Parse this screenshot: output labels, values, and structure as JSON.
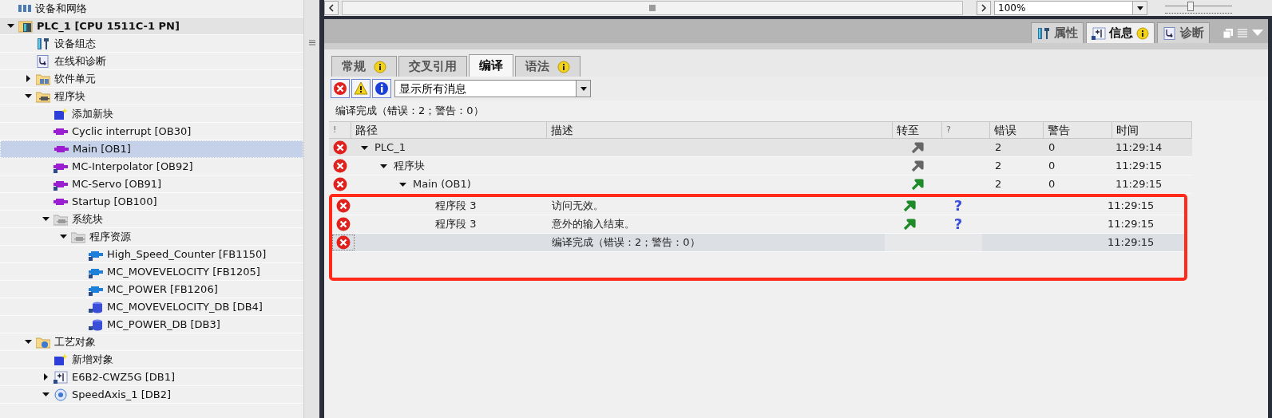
{
  "project_tree": {
    "items": [
      {
        "label": "设备和网络",
        "kind": "network",
        "selected": false
      },
      {
        "label": "PLC_1 [CPU 1511C-1 PN]",
        "kind": "plc",
        "expanded": true,
        "selected": false,
        "children": [
          {
            "label": "设备组态",
            "kind": "config",
            "selected": false
          },
          {
            "label": "在线和诊断",
            "kind": "diag",
            "selected": false
          },
          {
            "label": "软件单元",
            "kind": "unit_folder",
            "expanded": false,
            "selected": false
          },
          {
            "label": "程序块",
            "kind": "block_folder",
            "expanded": true,
            "selected": false,
            "children": [
              {
                "label": "添加新块",
                "kind": "add",
                "selected": false
              },
              {
                "label": "Cyclic interrupt [OB30]",
                "kind": "ob",
                "selected": false
              },
              {
                "label": "Main [OB1]",
                "kind": "ob",
                "selected": true
              },
              {
                "label": "MC-Interpolator [OB92]",
                "kind": "ob_lock",
                "selected": false
              },
              {
                "label": "MC-Servo [OB91]",
                "kind": "ob_lock",
                "selected": false
              },
              {
                "label": "Startup [OB100]",
                "kind": "ob",
                "selected": false
              },
              {
                "label": "系统块",
                "kind": "gray_folder",
                "expanded": true,
                "selected": false,
                "children": [
                  {
                    "label": "程序资源",
                    "kind": "gray_folder",
                    "expanded": true,
                    "selected": false,
                    "children": [
                      {
                        "label": "High_Speed_Counter [FB1150]",
                        "kind": "fb_lock",
                        "selected": false
                      },
                      {
                        "label": "MC_MOVEVELOCITY [FB1205]",
                        "kind": "fb_lock",
                        "selected": false
                      },
                      {
                        "label": "MC_POWER [FB1206]",
                        "kind": "fb_lock",
                        "selected": false
                      },
                      {
                        "label": "MC_MOVEVELOCITY_DB [DB4]",
                        "kind": "db_lock",
                        "selected": false
                      },
                      {
                        "label": "MC_POWER_DB [DB3]",
                        "kind": "db_lock",
                        "selected": false
                      }
                    ]
                  }
                ]
              }
            ]
          },
          {
            "label": "工艺对象",
            "kind": "tech_folder",
            "expanded": true,
            "selected": false,
            "children": [
              {
                "label": "新增对象",
                "kind": "add",
                "selected": false
              },
              {
                "label": "E6B2-CWZ5G [DB1]",
                "kind": "counter",
                "expanded": false,
                "selected": false
              },
              {
                "label": "SpeedAxis_1 [DB2]",
                "kind": "axis",
                "expanded": true,
                "selected": false
              }
            ]
          }
        ]
      }
    ]
  },
  "editor_toolbar": {
    "zoom": "100%",
    "zoom_slider": {
      "level": 0.38
    }
  },
  "inspector_tabs": [
    {
      "label": "属性",
      "kind": "properties",
      "badge": false,
      "selected": false
    },
    {
      "label": "信息",
      "kind": "info",
      "badge": true,
      "selected": true
    },
    {
      "label": "诊断",
      "kind": "diag",
      "badge": false,
      "selected": false
    }
  ],
  "info_tabs": [
    {
      "label": "常规",
      "badge": true,
      "selected": false
    },
    {
      "label": "交叉引用",
      "badge": false,
      "selected": false
    },
    {
      "label": "编译",
      "badge": false,
      "selected": true
    },
    {
      "label": "语法",
      "badge": true,
      "selected": false
    }
  ],
  "filter_buttons": [
    {
      "kind": "error"
    },
    {
      "kind": "warning"
    },
    {
      "kind": "info"
    }
  ],
  "filter_select": {
    "value": "显示所有消息"
  },
  "summary": "编译完成（错误：2；警告：0）",
  "table": {
    "columns": [
      "!",
      "路径",
      "描述",
      "转至",
      "?",
      "错误",
      "警告",
      "时间"
    ],
    "rows": [
      {
        "kind": "error",
        "path": "PLC_1",
        "expanded": true,
        "goto_enabled": false,
        "errors": "2",
        "warnings": "0",
        "time": "11:29:14",
        "selected": false,
        "children": [
          {
            "kind": "error",
            "path": "程序块",
            "expanded": true,
            "goto_enabled": false,
            "errors": "2",
            "warnings": "0",
            "time": "11:29:15",
            "selected": false,
            "children": [
              {
                "kind": "error",
                "path": "Main (OB1)",
                "expanded": true,
                "goto_enabled": true,
                "errors": "2",
                "warnings": "0",
                "time": "11:29:15",
                "selected": false,
                "children": [
                  {
                    "kind": "error",
                    "path": "程序段 3",
                    "description": "访问无效。",
                    "goto_enabled": true,
                    "help": true,
                    "time": "11:29:15",
                    "selected": false,
                    "highlighted": true
                  },
                  {
                    "kind": "error",
                    "path": "程序段 3",
                    "description": "意外的输入结束。",
                    "goto_enabled": true,
                    "help": true,
                    "time": "11:29:15",
                    "selected": false,
                    "highlighted": true
                  }
                ]
              }
            ]
          }
        ]
      },
      {
        "kind": "error",
        "description": "编译完成（错误：2；警告：0）",
        "time": "11:29:15",
        "selected": true,
        "highlighted": true
      }
    ]
  }
}
